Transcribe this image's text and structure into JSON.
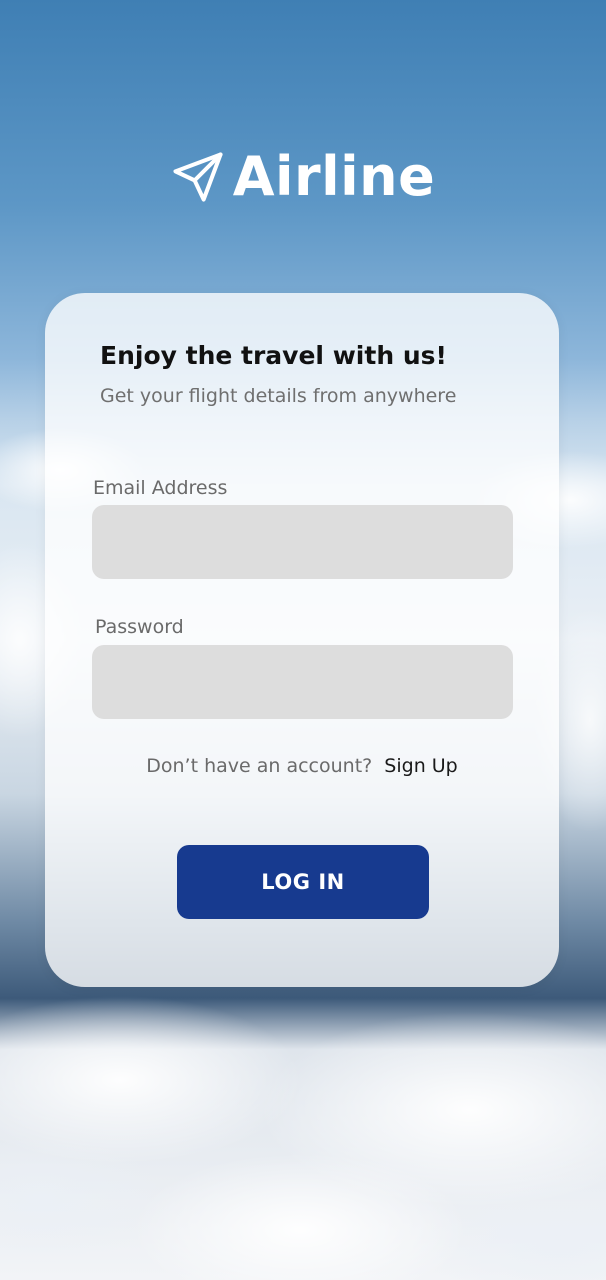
{
  "header": {
    "brand_name": "Airline",
    "logo_icon": "paper-plane-icon"
  },
  "login_card": {
    "title": "Enjoy the travel with us!",
    "subtitle": "Get your flight details from anywhere",
    "email": {
      "label": "Email Address",
      "value": "",
      "placeholder": ""
    },
    "password": {
      "label": "Password",
      "value": "",
      "placeholder": ""
    },
    "signup": {
      "prompt": "Don’t have an account?",
      "link_label": "Sign Up"
    },
    "login_button_label": "LOG IN"
  },
  "colors": {
    "primary_button": "#173a8f",
    "input_background": "#dddddd",
    "brand_text": "#ffffff"
  }
}
